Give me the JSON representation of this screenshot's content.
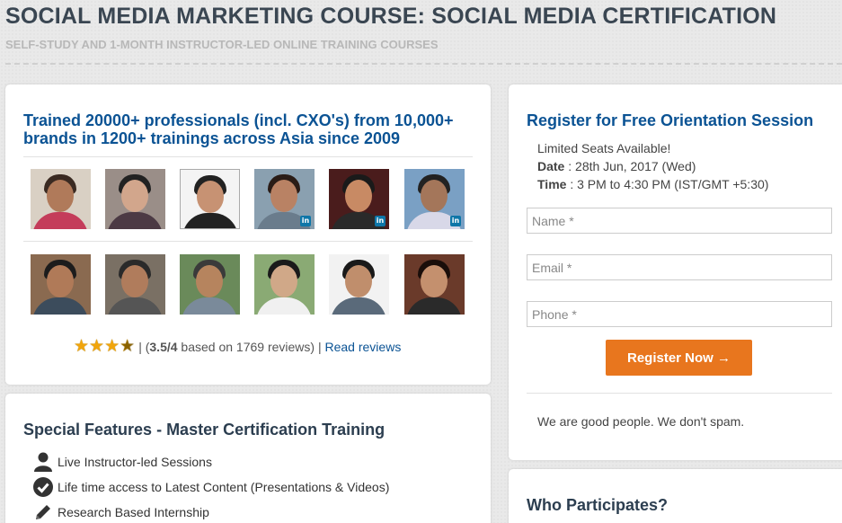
{
  "header": {
    "title": "SOCIAL MEDIA MARKETING COURSE: SOCIAL MEDIA CERTIFICATION",
    "subtitle": "SELF-STUDY AND 1-MONTH INSTRUCTOR-LED ONLINE TRAINING COURSES"
  },
  "trained": {
    "title": "Trained 20000+ professionals (incl. CXO's) from 10,000+ brands in 1200+ trainings across Asia since 2009",
    "rating_prefix": "| (",
    "rating_value": "3.5/4",
    "rating_suffix": " based on 1769 reviews) |",
    "rating_stars": 3.5,
    "read_reviews": "Read reviews",
    "linkedin_badge": "in"
  },
  "register": {
    "title": "Register for Free Orientation Session",
    "limited": "Limited Seats Available!",
    "date_label": "Date",
    "date_value": " : 28th Jun, 2017 (Wed)",
    "time_label": "Time",
    "time_value": " : 3 PM to 4:30 PM (IST/GMT +5:30)",
    "name_placeholder": "Name *",
    "email_placeholder": "Email *",
    "phone_placeholder": "Phone *",
    "button": "Register Now →",
    "nospam": "We are good people. We don't spam."
  },
  "special": {
    "title": "Special Features - Master Certification Training",
    "items": [
      {
        "icon": "user-icon",
        "label": "Live Instructor-led Sessions"
      },
      {
        "icon": "check-circle-icon",
        "label": "Life time access to Latest Content (Presentations & Videos)"
      },
      {
        "icon": "pencil-icon",
        "label": "Research Based Internship"
      }
    ]
  },
  "who": {
    "title": "Who Participates?"
  },
  "colors": {
    "link_blue": "#0b5394",
    "button_orange": "#e8761e",
    "star_gold": "#f1a50c",
    "linkedin_blue": "#0e76a8"
  }
}
